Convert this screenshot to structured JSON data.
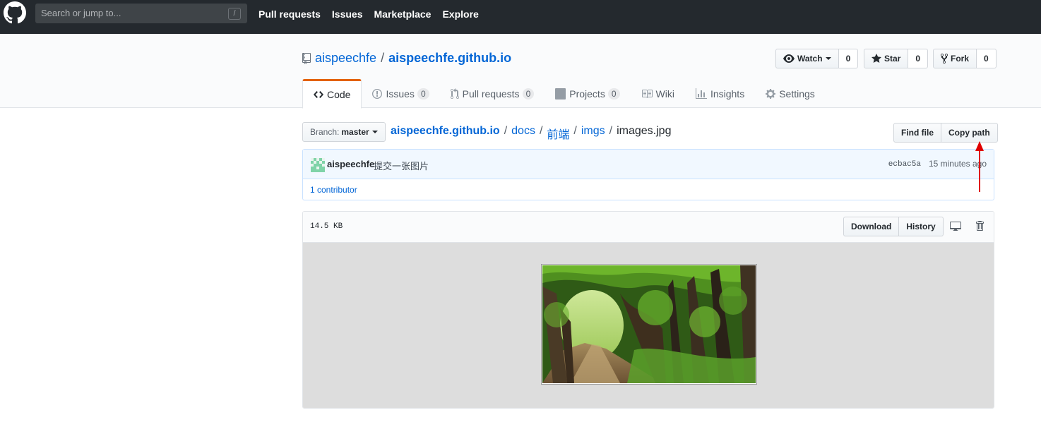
{
  "topbar": {
    "search_placeholder": "Search or jump to...",
    "search_shortcut": "/",
    "nav": [
      "Pull requests",
      "Issues",
      "Marketplace",
      "Explore"
    ]
  },
  "repo": {
    "owner": "aispeechfe",
    "separator": "/",
    "name": "aispeechfe.github.io",
    "actions": {
      "watch_label": "Watch",
      "watch_count": "0",
      "star_label": "Star",
      "star_count": "0",
      "fork_label": "Fork",
      "fork_count": "0"
    },
    "tabs": [
      {
        "label": "Code",
        "counter": null
      },
      {
        "label": "Issues",
        "counter": "0"
      },
      {
        "label": "Pull requests",
        "counter": "0"
      },
      {
        "label": "Projects",
        "counter": "0"
      },
      {
        "label": "Wiki",
        "counter": null
      },
      {
        "label": "Insights",
        "counter": null
      },
      {
        "label": "Settings",
        "counter": null
      }
    ]
  },
  "filenav": {
    "branch_prefix": "Branch:",
    "branch": "master",
    "breadcrumb": [
      "aispeechfe.github.io",
      "docs",
      "前端",
      "imgs"
    ],
    "separator": "/",
    "filename": "images.jpg",
    "find_file": "Find file",
    "copy_path": "Copy path"
  },
  "commit": {
    "author": "aispeechfe",
    "message": "提交一张图片",
    "sha": "ecbac5a",
    "time": "15 minutes ago",
    "contributors": "1 contributor"
  },
  "file": {
    "size": "14.5 KB",
    "download": "Download",
    "history": "History",
    "display_icon": "desktop-icon",
    "delete_icon": "trashcan-icon"
  },
  "colors": {
    "topbar": "#24292e",
    "link": "#0366d6",
    "selected_tab_accent": "#e36209",
    "annotation_arrow": "#e00000"
  }
}
